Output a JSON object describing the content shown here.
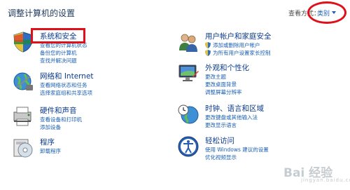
{
  "header": {
    "title": "调整计算机的设置",
    "view_by_label": "查看方式：",
    "view_by_value": "类别"
  },
  "categories": [
    {
      "heading": "系统和安全",
      "links": [
        "查看您的计算机状态",
        "备份您的计算机",
        "查找并解决问题"
      ],
      "icon": "shield-system-icon"
    },
    {
      "heading": "网络和 Internet",
      "links": [
        "查看网络状态和任务",
        "选择家庭组和共享选项"
      ],
      "icon": "network-globe-icon"
    },
    {
      "heading": "硬件和声音",
      "links": [
        "查看设备和打印机",
        "添加设备"
      ],
      "icon": "printer-icon"
    },
    {
      "heading": "程序",
      "links": [
        "卸载程序"
      ],
      "icon": "programs-disc-icon"
    },
    {
      "heading": "用户帐户和家庭安全",
      "links": [
        "添加或删除用户帐户",
        "为所有用户设置家长控制"
      ],
      "icon": "users-icon"
    },
    {
      "heading": "外观和个性化",
      "links": [
        "更改主题",
        "更改桌面背景",
        "调整屏幕分辨率"
      ],
      "icon": "monitor-icon"
    },
    {
      "heading": "时钟、语言和区域",
      "links": [
        "更改键盘或其他输入法",
        "更改显示语言"
      ],
      "icon": "clock-globe-icon"
    },
    {
      "heading": "轻松访问",
      "links": [
        "使用 Windows 建议的设置",
        "优化视频显示"
      ],
      "icon": "ease-of-access-icon"
    }
  ],
  "watermark": {
    "text": "Bai 经验",
    "sub": "jingyan.baidu.com"
  },
  "colors": {
    "heading": "#0c3b8c",
    "link": "#1a5fb4",
    "highlight": "#e0101a"
  }
}
